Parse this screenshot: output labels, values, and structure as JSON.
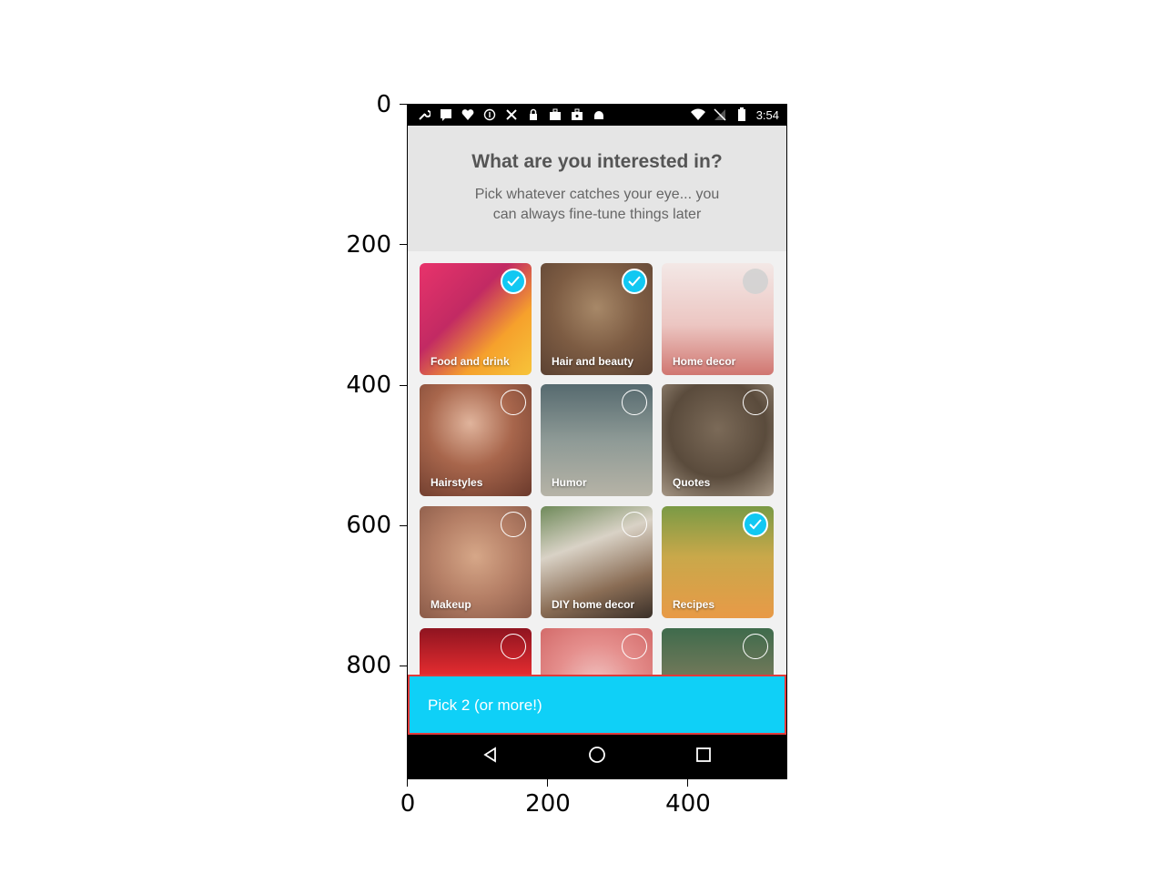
{
  "axes": {
    "y_ticks": [
      "0",
      "200",
      "400",
      "600",
      "800"
    ],
    "x_ticks": [
      "0",
      "200",
      "400"
    ]
  },
  "statusbar": {
    "time": "3:54",
    "left_icons": [
      "wrench-icon",
      "message-icon",
      "heart-icon",
      "info-icon",
      "tools-icon",
      "lock-icon",
      "briefcase-upload-icon",
      "briefcase-icon",
      "android-icon"
    ],
    "right_icons": [
      "wifi-icon",
      "no-signal-icon",
      "battery-icon"
    ]
  },
  "header": {
    "title": "What are you interested in?",
    "subtitle_line1": "Pick whatever catches your eye... you",
    "subtitle_line2": "can always fine-tune things later"
  },
  "tiles": [
    {
      "label": "Food and drink",
      "selected": true
    },
    {
      "label": "Hair and beauty",
      "selected": true
    },
    {
      "label": "Home decor",
      "selected": false
    },
    {
      "label": "Hairstyles",
      "selected": false
    },
    {
      "label": "Humor",
      "selected": false
    },
    {
      "label": "Quotes",
      "selected": false
    },
    {
      "label": "Makeup",
      "selected": false
    },
    {
      "label": "DIY home decor",
      "selected": false
    },
    {
      "label": "Recipes",
      "selected": true
    },
    {
      "label": "",
      "selected": false
    },
    {
      "label": "",
      "selected": false
    },
    {
      "label": "",
      "selected": false
    }
  ],
  "cta": {
    "label": "Pick 2 (or more!)"
  },
  "colors": {
    "accent": "#11c8f2",
    "cta": "#0fd0f7",
    "cta_border": "#e13a3a"
  },
  "navbar": {
    "icons": [
      "back-icon",
      "home-icon",
      "recents-icon"
    ]
  }
}
